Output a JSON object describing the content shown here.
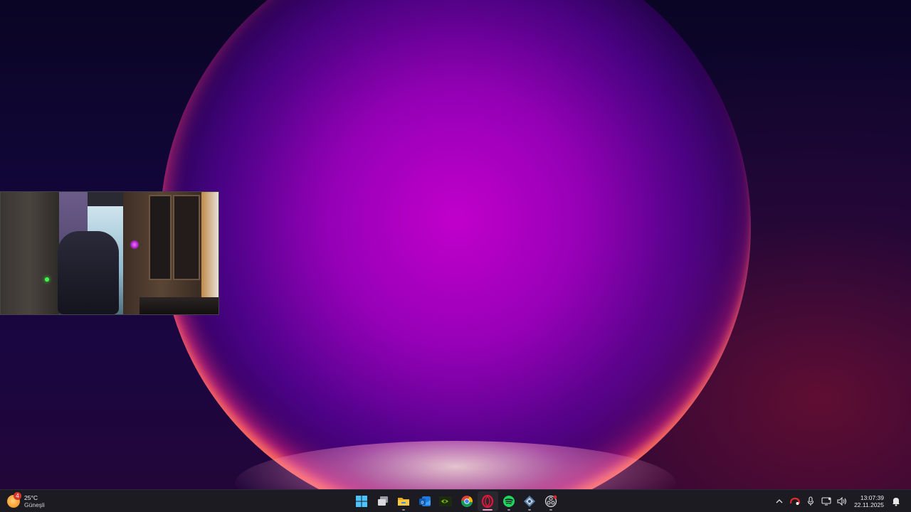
{
  "weather": {
    "temperature": "25°C",
    "condition": "Güneşli",
    "badge_count": "4",
    "icon": "sun-icon"
  },
  "taskbar": {
    "apps": [
      {
        "name": "start-button",
        "icon": "windows-logo-icon",
        "running": false
      },
      {
        "name": "taskbar-app-task-view",
        "icon": "task-view-icon",
        "running": false
      },
      {
        "name": "taskbar-app-file-explorer",
        "icon": "folder-icon",
        "running": true
      },
      {
        "name": "taskbar-app-outlook",
        "icon": "outlook-icon",
        "running": false
      },
      {
        "name": "taskbar-app-nvidia",
        "icon": "nvidia-icon",
        "running": false
      },
      {
        "name": "taskbar-app-chrome",
        "icon": "chrome-icon",
        "running": false
      },
      {
        "name": "taskbar-app-opera-gx",
        "icon": "opera-gx-icon",
        "running": true,
        "active": true
      },
      {
        "name": "taskbar-app-spotify",
        "icon": "spotify-icon",
        "running": true
      },
      {
        "name": "taskbar-app-network-tool",
        "icon": "network-icon",
        "running": true
      },
      {
        "name": "taskbar-app-obs",
        "icon": "obs-icon",
        "running": true
      }
    ]
  },
  "tray": {
    "icons": [
      "chevron-up-icon",
      "red-app-tray-icon",
      "microphone-icon",
      "display-icon",
      "speaker-icon"
    ]
  },
  "clock": {
    "time": "13:07:39",
    "date": "22.11.2025"
  },
  "colors": {
    "taskbar_bg": "#1c1b22",
    "wallpaper_accent": "#b400c8",
    "active_indicator": "#e8a0c4"
  },
  "camera_preview": {
    "icon": "camera-preview-window"
  }
}
